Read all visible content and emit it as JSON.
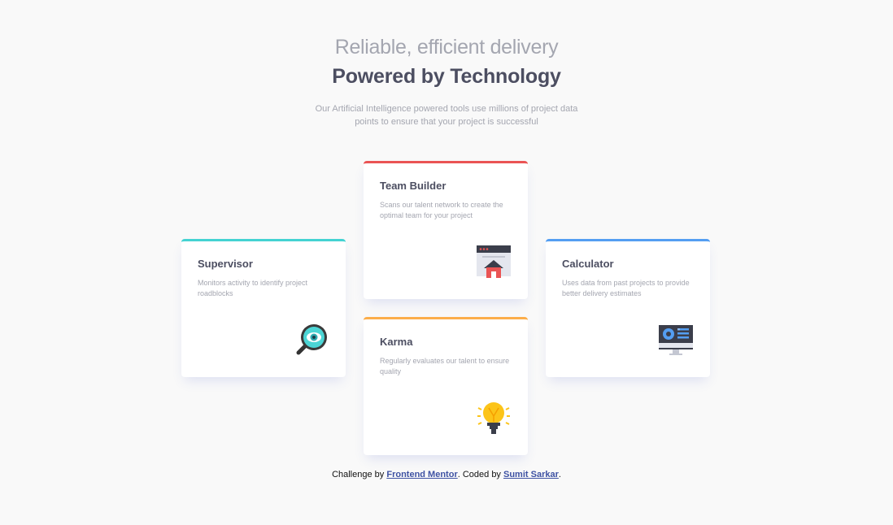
{
  "header": {
    "subtitle": "Reliable, efficient delivery",
    "title": "Powered by Technology",
    "intro": "Our Artificial Intelligence powered tools use millions of project data points to ensure that your project is successful"
  },
  "cards": [
    {
      "title": "Supervisor",
      "description": "Monitors activity to identify project roadblocks",
      "icon": "magnifier-icon",
      "accent": "#44d3d2"
    },
    {
      "title": "Team Builder",
      "description": "Scans our talent network to create the optimal team for your project",
      "icon": "team-builder-icon",
      "accent": "#ea5454"
    },
    {
      "title": "Karma",
      "description": "Regularly evaluates our talent to ensure quality",
      "icon": "lightbulb-icon",
      "accent": "#fcae4a"
    },
    {
      "title": "Calculator",
      "description": "Uses data from past projects to provide better delivery estimates",
      "icon": "calculator-monitor-icon",
      "accent": "#549ef2"
    }
  ],
  "footer": {
    "prefix": "Challenge by",
    "link1": "Frontend Mentor",
    "middle": ". Coded by",
    "link2": "Sumit Sarkar",
    "suffix": "."
  }
}
